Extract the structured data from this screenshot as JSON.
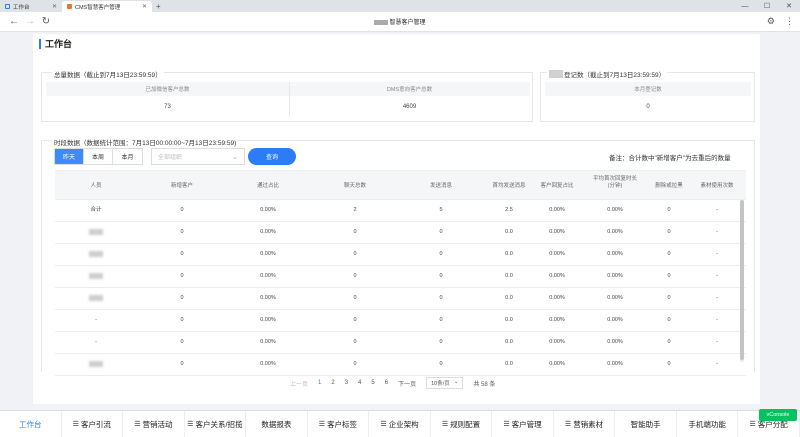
{
  "browser": {
    "tabs": [
      {
        "label": "工作台",
        "active": false
      },
      {
        "label": "CMS智慧客户管理",
        "active": true
      }
    ],
    "page_title": "智慧客户管理"
  },
  "heading": "工作台",
  "total_card": {
    "title": "总量数据（截止到7月13日23:59:59）",
    "headers": [
      "已加微信客户总数",
      "DMS意向客户总数"
    ],
    "values": [
      "73",
      "4609"
    ]
  },
  "reg_card": {
    "title": "登记数（截止到7月13日23:59:59）",
    "header": "本月登记数",
    "value": "0"
  },
  "period": {
    "title": "时段数据（数据统计范围：7月13日00:00:00~7月13日23:59:59)",
    "segments": [
      "昨天",
      "本周",
      "本月"
    ],
    "active_segment": "昨天",
    "select_placeholder": "全部组织",
    "query_label": "查询",
    "note": "备注：合计数中\"新增客户\"为去重后的数量"
  },
  "table": {
    "headers": [
      "人员",
      "新增客户",
      "通过占比",
      "聊天总数",
      "发送消息",
      "首均发送消息",
      "客户回复占比",
      "平均首次回复时长\n(分钟)",
      "删除或拉黑",
      "素材使用次数"
    ],
    "rows": [
      {
        "name": "合计",
        "values": [
          "0",
          "0.00%",
          "2",
          "5",
          "2.5",
          "0.00%",
          "0.00%",
          "0",
          "-"
        ]
      },
      {
        "name": "",
        "values": [
          "0",
          "0.00%",
          "0",
          "0",
          "0.0",
          "0.00%",
          "0.00%",
          "0",
          "-"
        ]
      },
      {
        "name": "",
        "values": [
          "0",
          "0.00%",
          "0",
          "0",
          "0.0",
          "0.00%",
          "0.00%",
          "0",
          "-"
        ]
      },
      {
        "name": "",
        "values": [
          "0",
          "0.00%",
          "0",
          "0",
          "0.0",
          "0.00%",
          "0.00%",
          "0",
          "-"
        ]
      },
      {
        "name": "",
        "values": [
          "0",
          "0.00%",
          "0",
          "0",
          "0.0",
          "0.00%",
          "0.00%",
          "0",
          "-"
        ]
      },
      {
        "name": "-",
        "values": [
          "0",
          "0.00%",
          "0",
          "0",
          "0.0",
          "0.00%",
          "0.00%",
          "0",
          "-"
        ]
      },
      {
        "name": "-",
        "values": [
          "0",
          "0.00%",
          "0",
          "0",
          "0.0",
          "0.00%",
          "0.00%",
          "0",
          "-"
        ]
      },
      {
        "name": "",
        "values": [
          "0",
          "0.00%",
          "0",
          "0",
          "0.0",
          "0.00%",
          "0.00%",
          "0",
          "-"
        ]
      }
    ]
  },
  "pager": {
    "prev": "上一页",
    "pages": [
      "1",
      "2",
      "3",
      "4",
      "5",
      "6"
    ],
    "current": "1",
    "next": "下一页",
    "page_size": "10条/页",
    "total": "共 58 条"
  },
  "bottom_nav": [
    {
      "label": "工作台",
      "active": true,
      "menu": false
    },
    {
      "label": "客户引流",
      "active": false,
      "menu": true
    },
    {
      "label": "营销活动",
      "active": false,
      "menu": true
    },
    {
      "label": "客户关系/招揽",
      "active": false,
      "menu": true
    },
    {
      "label": "数据报表",
      "active": false,
      "menu": false
    },
    {
      "label": "客户标签",
      "active": false,
      "menu": true
    },
    {
      "label": "企业架构",
      "active": false,
      "menu": true
    },
    {
      "label": "规则配置",
      "active": false,
      "menu": true
    },
    {
      "label": "客户管理",
      "active": false,
      "menu": true
    },
    {
      "label": "营销素材",
      "active": false,
      "menu": true
    },
    {
      "label": "智能助手",
      "active": false,
      "menu": false
    },
    {
      "label": "手机端功能",
      "active": false,
      "menu": false
    },
    {
      "label": "客户分配",
      "active": false,
      "menu": true
    }
  ],
  "vconsole": "vConsole",
  "colors": {
    "accent": "#2b7cf6",
    "vconsole": "#07c160"
  },
  "icons": [
    "back-icon",
    "forward-icon",
    "refresh-icon",
    "settings-icon",
    "more-icon",
    "chevron-down-icon",
    "hamburger-icon"
  ]
}
